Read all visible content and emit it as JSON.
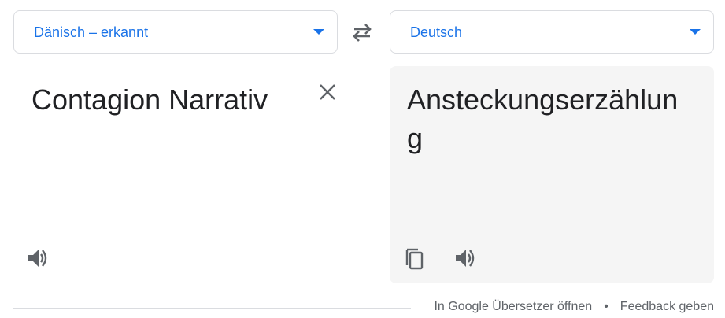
{
  "source_lang": {
    "label": "Dänisch – erkannt",
    "caret_icon": "chevron-down-icon"
  },
  "target_lang": {
    "label": "Deutsch",
    "caret_icon": "chevron-down-icon"
  },
  "swap_icon": "swap-arrows-icon",
  "source": {
    "text": "Contagion Narrativ",
    "clear_icon": "close-icon",
    "listen_icon": "speaker-icon"
  },
  "target": {
    "text": "Ansteckungserzählung",
    "copy_icon": "copy-icon",
    "listen_icon": "speaker-icon"
  },
  "footer": {
    "open_link": "In Google Übersetzer öffnen",
    "separator": "•",
    "feedback_link": "Feedback geben"
  },
  "colors": {
    "accent": "#1a73e8",
    "icon": "#5f6368",
    "text": "#202124",
    "target_bg": "#f5f5f5",
    "border": "#dadce0"
  }
}
